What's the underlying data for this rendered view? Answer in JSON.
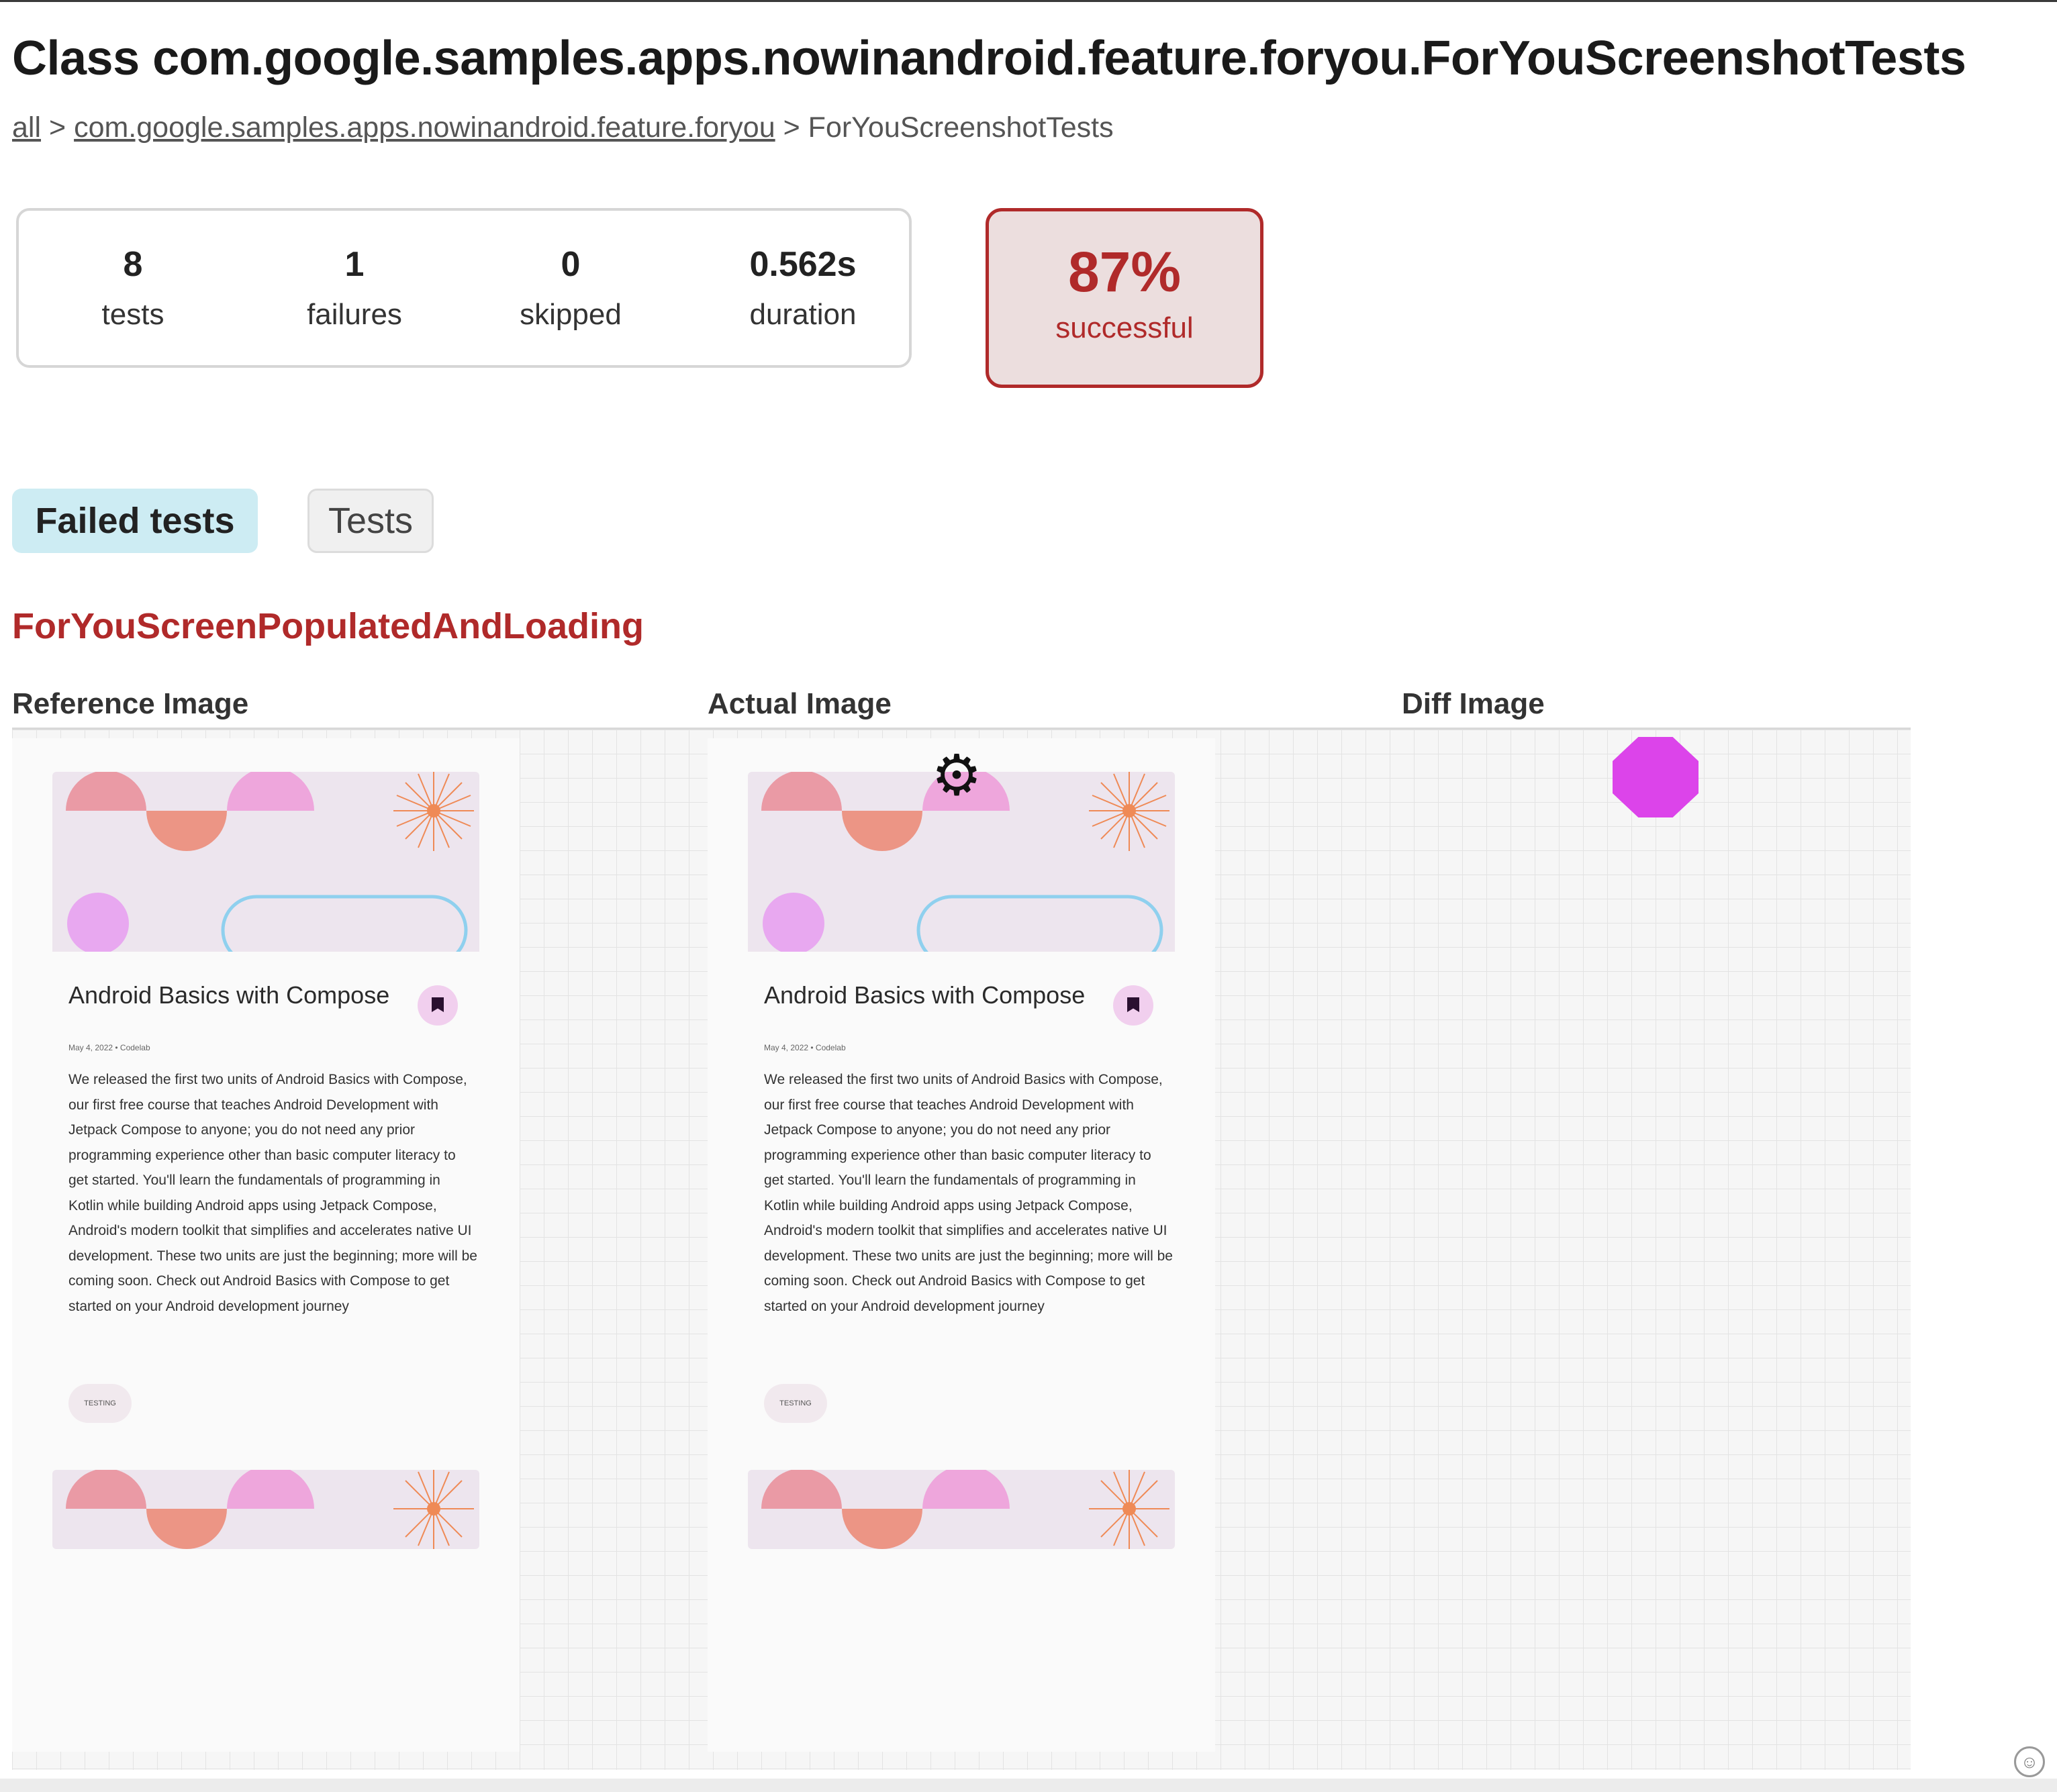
{
  "page": {
    "title": "Class com.google.samples.apps.nowinandroid.feature.foryou.ForYouScreenshotTests",
    "breadcrumb": [
      {
        "label": "all",
        "link": true
      },
      {
        "label": "com.google.samples.apps.nowinandroid.feature.foryou",
        "link": true
      },
      {
        "label": "ForYouScreenshotTests",
        "link": false
      }
    ],
    "separator": ">"
  },
  "summary": {
    "counters": [
      {
        "value": "8",
        "label": "tests"
      },
      {
        "value": "1",
        "label": "failures"
      },
      {
        "value": "0",
        "label": "skipped"
      },
      {
        "value": "0.562s",
        "label": "duration"
      }
    ],
    "success_rate": {
      "value": "87%",
      "label": "successful",
      "color": "#b02a2a"
    }
  },
  "tabs": [
    {
      "label": "Failed tests",
      "active": true
    },
    {
      "label": "Tests",
      "active": false
    }
  ],
  "failed_test": {
    "name": "ForYouScreenPopulatedAndLoading",
    "image_labels": {
      "reference": "Reference Image",
      "actual": "Actual Image",
      "diff": "Diff Image"
    }
  },
  "card": {
    "title": "Android Basics with Compose",
    "date": "May 4, 2022 • Codelab",
    "body": "We released the first two units of Android Basics with Compose, our first free course that teaches Android Development with Jetpack Compose to anyone; you do not need any prior programming experience other than basic computer literacy to get started. You'll learn the fundamentals of programming in Kotlin while building Android apps using Jetpack Compose, Android's modern toolkit that simplifies and accelerates native UI development. These two units are just the beginning; more will be coming soon. Check out Android Basics with Compose to get started on your Android development journey",
    "topic": "TESTING"
  },
  "icons": {
    "bookmark": "bookmark-icon",
    "loading": "loading-gear-icon",
    "corner": "feedback-icon"
  },
  "colors": {
    "failure": "#b02a2a",
    "active_tab": "#cdecf3",
    "diff_highlight": "#dc44ea",
    "banner_bg": "#ede5ee"
  }
}
